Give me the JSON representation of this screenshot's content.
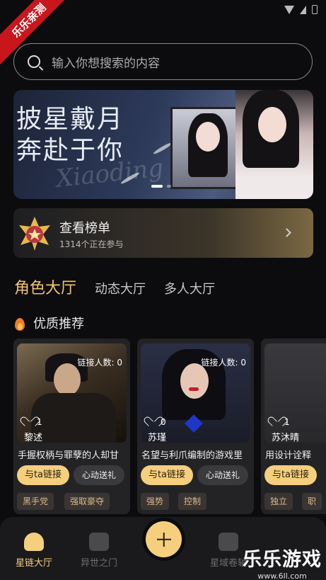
{
  "corner_badge": "乐乐亲测",
  "search": {
    "placeholder": "输入你想搜索的内容"
  },
  "banner": {
    "title_line1": "披星戴月",
    "title_line2": "奔赴于你",
    "script_text": "Xiaoding",
    "slides": 2,
    "active_slide": 0
  },
  "rank": {
    "title": "查看榜单",
    "subtitle": "1314个正在参与"
  },
  "tabs": [
    {
      "label": "角色大厅",
      "active": true
    },
    {
      "label": "动态大厅",
      "active": false
    },
    {
      "label": "多人大厅",
      "active": false
    }
  ],
  "section": {
    "title": "优质推荐"
  },
  "cards": [
    {
      "connections": "链接人数: 0",
      "likes": "1",
      "name": "黎述",
      "desc": "手握权柄与罪孽的人却甘",
      "link_label": "与ta链接",
      "gift_label": "心动送礼",
      "tags": [
        "黑手党",
        "强取豪夺"
      ]
    },
    {
      "connections": "链接人数: 0",
      "likes": "0",
      "name": "苏瑾",
      "desc": "名望与利爪编制的游戏里",
      "link_label": "与ta链接",
      "gift_label": "心动送礼",
      "tags": [
        "强势",
        "控制"
      ]
    },
    {
      "connections": "",
      "likes": "1",
      "name": "苏沐晴",
      "desc": "用设计诠释",
      "link_label": "与ta链接",
      "gift_label": "",
      "tags": [
        "独立",
        "职"
      ]
    }
  ],
  "bottom_nav": [
    {
      "label": "星链大厅",
      "icon": "home-icon",
      "active": true
    },
    {
      "label": "异世之门",
      "icon": "gate-icon",
      "active": false
    },
    {
      "label": "星域卷轴",
      "icon": "scroll-icon",
      "active": false
    }
  ],
  "fab": {
    "icon": "plus-icon"
  },
  "watermark": {
    "title": "乐乐游戏",
    "url": "www.6ll.com"
  },
  "colors": {
    "accent": "#f5cf7e",
    "active_tab": "#f2c46f",
    "background": "#0c0c0e"
  }
}
